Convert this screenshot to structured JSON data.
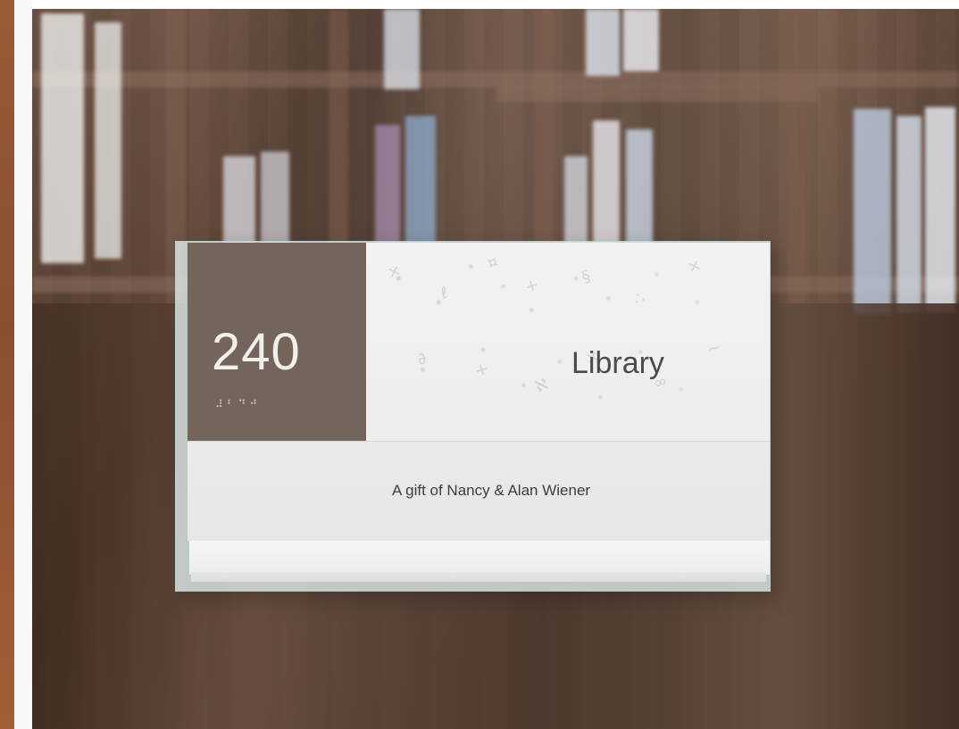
{
  "scene": {
    "sign": {
      "room_number": "240",
      "braille_text": "⠼⠃⠙⠚",
      "room_name": "Library",
      "gift_text": "A gift of Nancy & Alan Wiener"
    }
  },
  "colors": {
    "number_panel": "#73655b",
    "sign_background": "#efefef",
    "text_primary": "#4b4b4b"
  }
}
